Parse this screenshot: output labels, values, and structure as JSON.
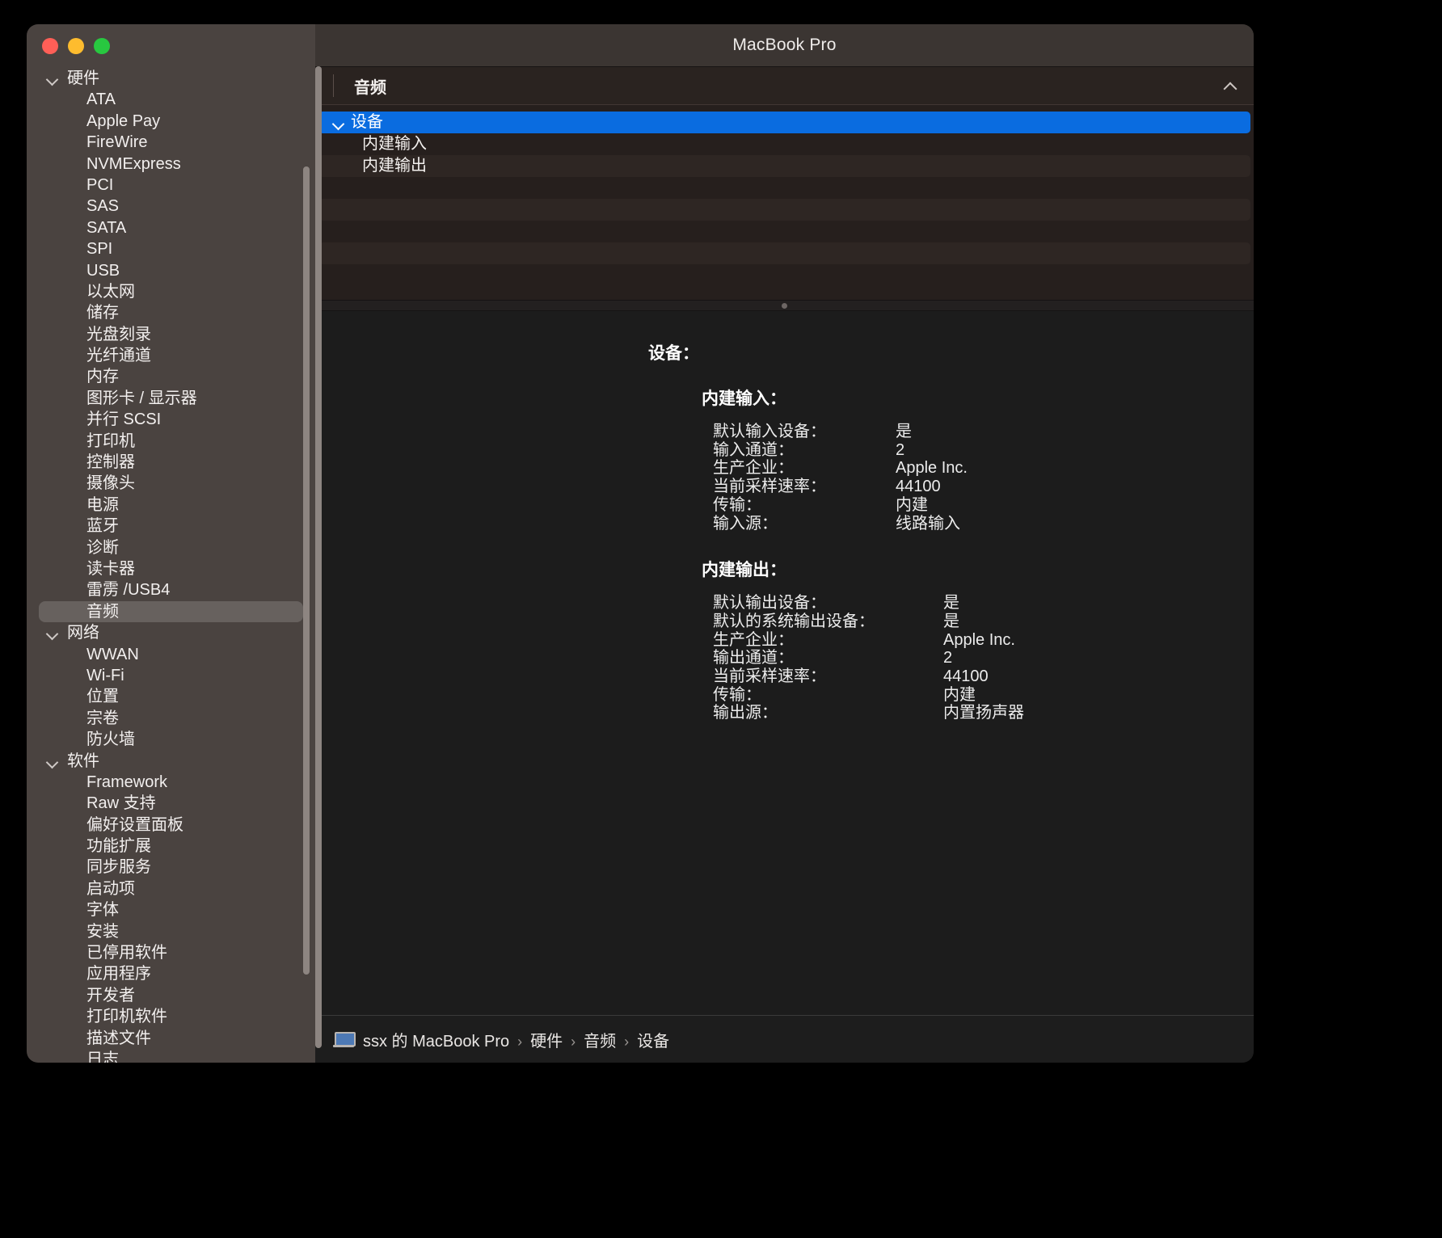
{
  "window": {
    "title": "MacBook Pro",
    "traffic_lights": [
      "close",
      "minimize",
      "maximize"
    ]
  },
  "sidebar": {
    "groups": [
      {
        "label": "硬件",
        "items": [
          "ATA",
          "Apple Pay",
          "FireWire",
          "NVMExpress",
          "PCI",
          "SAS",
          "SATA",
          "SPI",
          "USB",
          "以太网",
          "储存",
          "光盘刻录",
          "光纤通道",
          "内存",
          "图形卡 / 显示器",
          "并行 SCSI",
          "打印机",
          "控制器",
          "摄像头",
          "电源",
          "蓝牙",
          "诊断",
          "读卡器",
          "雷雳 /USB4",
          "音频"
        ],
        "selected": "音频"
      },
      {
        "label": "网络",
        "items": [
          "WWAN",
          "Wi-Fi",
          "位置",
          "宗卷",
          "防火墙"
        ],
        "selected": null
      },
      {
        "label": "软件",
        "items": [
          "Framework",
          "Raw 支持",
          "偏好设置面板",
          "功能扩展",
          "同步服务",
          "启动项",
          "字体",
          "安装",
          "已停用软件",
          "应用程序",
          "开发者",
          "打印机软件",
          "描述文件",
          "日志"
        ],
        "selected": null
      }
    ]
  },
  "table": {
    "column_header": "音频",
    "collapse_icon": "chevron-up-icon",
    "rows": [
      {
        "label": "设备",
        "level": 0,
        "selected": true,
        "disclosure": "chevron-down-icon"
      },
      {
        "label": "内建输入",
        "level": 1,
        "selected": false,
        "disclosure": null
      },
      {
        "label": "内建输出",
        "level": 1,
        "selected": false,
        "disclosure": null
      },
      {
        "label": "",
        "level": 1,
        "selected": false,
        "disclosure": null
      },
      {
        "label": "",
        "level": 1,
        "selected": false,
        "disclosure": null
      },
      {
        "label": "",
        "level": 1,
        "selected": false,
        "disclosure": null
      },
      {
        "label": "",
        "level": 1,
        "selected": false,
        "disclosure": null
      }
    ]
  },
  "detail": {
    "heading": "设备：",
    "sections": [
      {
        "title": "内建输入：",
        "rows": [
          {
            "key": "默认输入设备：",
            "value": "是"
          },
          {
            "key": "输入通道：",
            "value": "2"
          },
          {
            "key": "生产企业：",
            "value": "Apple Inc."
          },
          {
            "key": "当前采样速率：",
            "value": "44100"
          },
          {
            "key": "传输：",
            "value": "内建"
          },
          {
            "key": "输入源：",
            "value": "线路输入"
          }
        ]
      },
      {
        "title": "内建输出：",
        "rows": [
          {
            "key": "默认输出设备：",
            "value": "是"
          },
          {
            "key": "默认的系统输出设备：",
            "value": "是"
          },
          {
            "key": "生产企业：",
            "value": "Apple Inc."
          },
          {
            "key": "输出通道：",
            "value": "2"
          },
          {
            "key": "当前采样速率：",
            "value": "44100"
          },
          {
            "key": "传输：",
            "value": "内建"
          },
          {
            "key": "输出源：",
            "value": "内置扬声器"
          }
        ]
      }
    ]
  },
  "footer": {
    "icon": "laptop-icon",
    "crumbs": [
      "ssx 的 MacBook Pro",
      "硬件",
      "音频",
      "设备"
    ],
    "separator": "›"
  },
  "colors": {
    "sidebar_bg": "#4a4340",
    "selection_blue": "#0a6ce0",
    "titlebar_bg": "#3b3532",
    "detail_bg": "#1c1c1c",
    "table_bg": "#261f1d"
  }
}
